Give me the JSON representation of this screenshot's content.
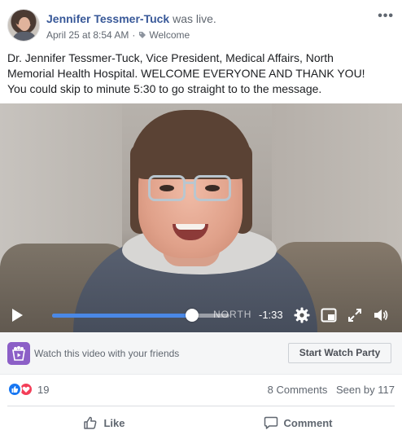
{
  "header": {
    "author_name": "Jennifer Tessmer-Tuck",
    "status_text": "was live.",
    "timestamp": "April 25 at 8:54 AM",
    "separator": "·",
    "audience_tag": "Welcome",
    "more_icon": "ellipsis-icon",
    "more_label": "•••"
  },
  "post": {
    "text_line1": "Dr. Jennifer Tessmer-Tuck, Vice President, Medical Affairs, North",
    "text_line2": "Memorial Health Hospital. WELCOME EVERYONE AND THANK YOU!",
    "text_line3": "You could skip to minute 5:30 to go straight to to the message."
  },
  "video": {
    "overlay_watermark": "NORTH",
    "progress_fraction": 0.79,
    "time_remaining": "-1:33",
    "accent_color": "#4a88e6",
    "icons": [
      "play-icon",
      "gear-icon",
      "picture-in-picture-icon",
      "fullscreen-icon",
      "volume-icon"
    ]
  },
  "watch_party": {
    "prompt": "Watch this video with your friends",
    "button_label": "Start Watch Party",
    "icon": "watch-party-icon"
  },
  "engagement": {
    "reaction_count": "19",
    "comments": "8 Comments",
    "seen_by": "Seen by 117",
    "reaction_colors": {
      "like": "#1877f2",
      "love": "#f33e58"
    }
  },
  "actions": {
    "like_label": "Like",
    "comment_label": "Comment"
  }
}
